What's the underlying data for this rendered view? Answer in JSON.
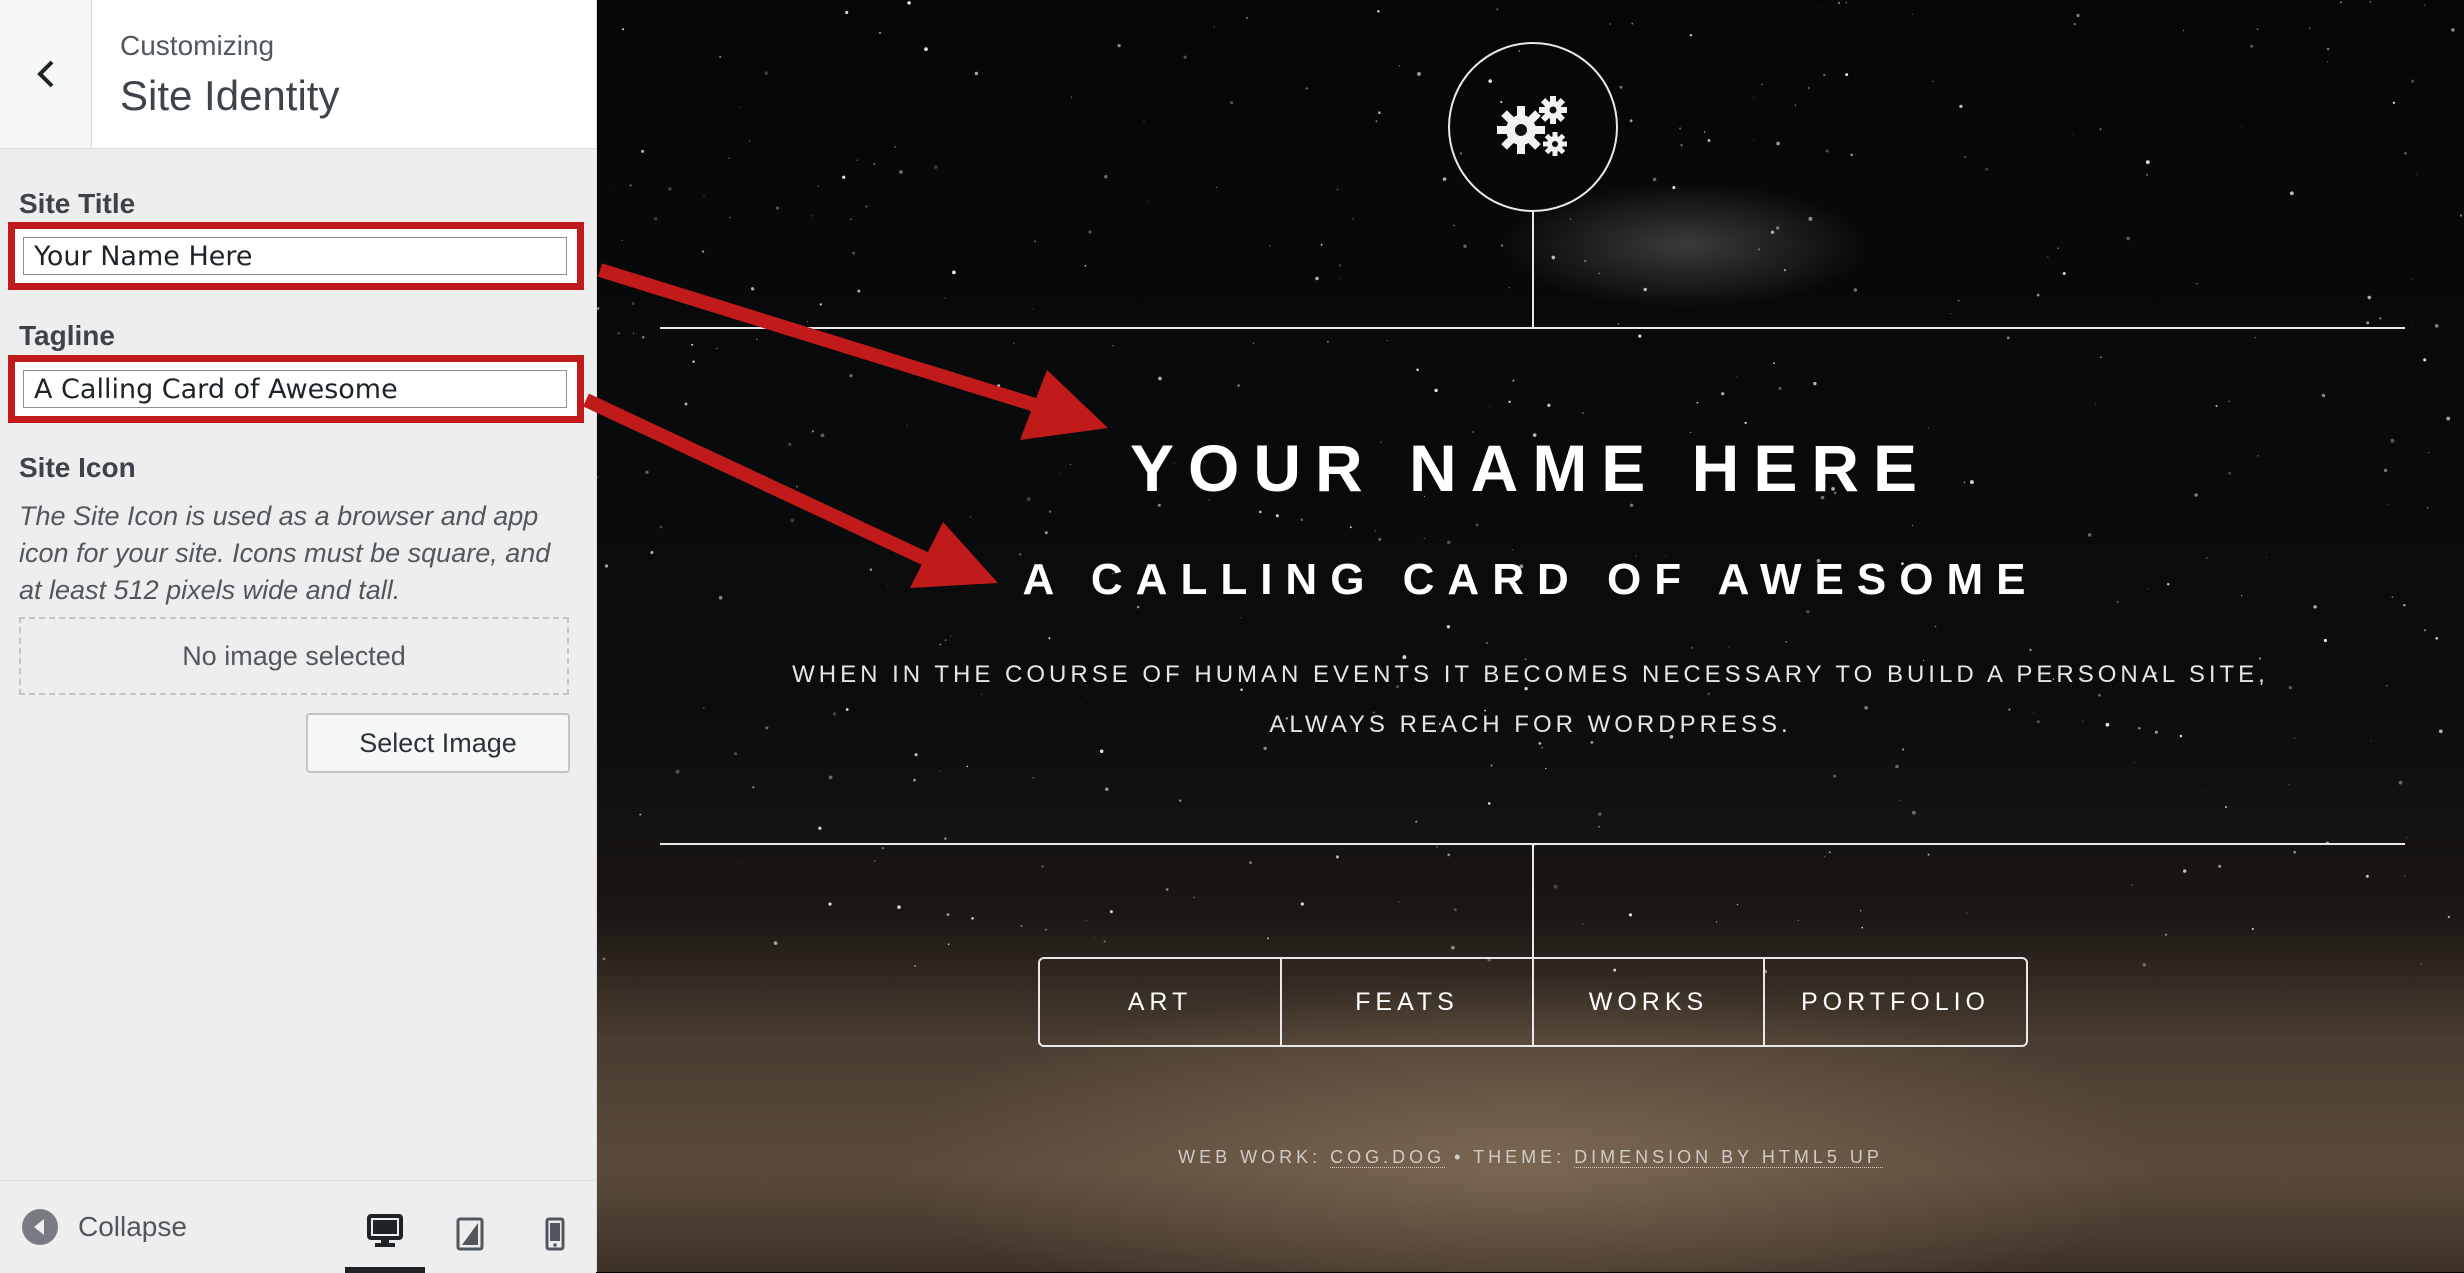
{
  "sidebar": {
    "header": {
      "customizing": "Customizing",
      "section_title": "Site Identity"
    },
    "site_title": {
      "label": "Site Title",
      "value": "Your Name Here"
    },
    "tagline": {
      "label": "Tagline",
      "value": "A Calling Card of Awesome"
    },
    "site_icon": {
      "label": "Site Icon",
      "description": "The Site Icon is used as a browser and app icon for your site. Icons must be square, and at least 512 pixels wide and tall.",
      "placeholder": "No image selected",
      "select_button": "Select Image"
    },
    "footer": {
      "collapse": "Collapse",
      "devices": [
        "desktop-icon",
        "tablet-icon",
        "mobile-icon"
      ],
      "active_device": "desktop"
    }
  },
  "preview": {
    "logo_icon": "gears-icon",
    "title": "YOUR NAME HERE",
    "tagline": "A CALLING CARD OF AWESOME",
    "intro_line1": "WHEN IN THE COURSE OF HUMAN EVENTS IT BECOMES NECESSARY TO BUILD A PERSONAL SITE,",
    "intro_line2": "ALWAYS REACH FOR WORDPRESS.",
    "nav": [
      "ART",
      "FEATS",
      "WORKS",
      "PORTFOLIO"
    ],
    "footer": {
      "web_work_label": "WEB WORK:",
      "web_work_link": "COG.DOG",
      "separator": "•",
      "theme_label": "THEME:",
      "theme_link": "DIMENSION BY HTML5 UP"
    }
  },
  "colors": {
    "highlight_red": "#c01a1a",
    "sidebar_bg": "#eeeeee",
    "preview_text": "#ffffff"
  }
}
